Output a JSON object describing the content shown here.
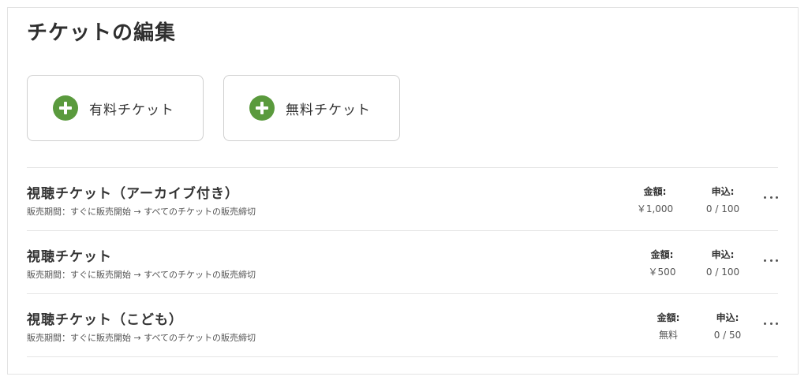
{
  "page": {
    "title": "チケットの編集"
  },
  "add_buttons": {
    "paid_label": "有料チケット",
    "free_label": "無料チケット"
  },
  "columns": {
    "price_label": "金額:",
    "apply_label": "申込:"
  },
  "tickets": [
    {
      "name": "視聴チケット（アーカイブ付き）",
      "period": "販売期間：すぐに販売開始 → すべてのチケットの販売締切",
      "price": "￥1,000",
      "apply": "0 / 100"
    },
    {
      "name": "視聴チケット",
      "period": "販売期間：すぐに販売開始 → すべてのチケットの販売締切",
      "price": "￥500",
      "apply": "0 / 100"
    },
    {
      "name": "視聴チケット（こども）",
      "period": "販売期間：すぐに販売開始 → すべてのチケットの販売締切",
      "price": "無料",
      "apply": "0 / 50"
    }
  ],
  "icons": {
    "add": "plus-circle-icon",
    "more": "more-horizontal-icon"
  },
  "colors": {
    "accent": "#5a9a3d",
    "text": "#333333",
    "border": "#e6e6e6"
  }
}
